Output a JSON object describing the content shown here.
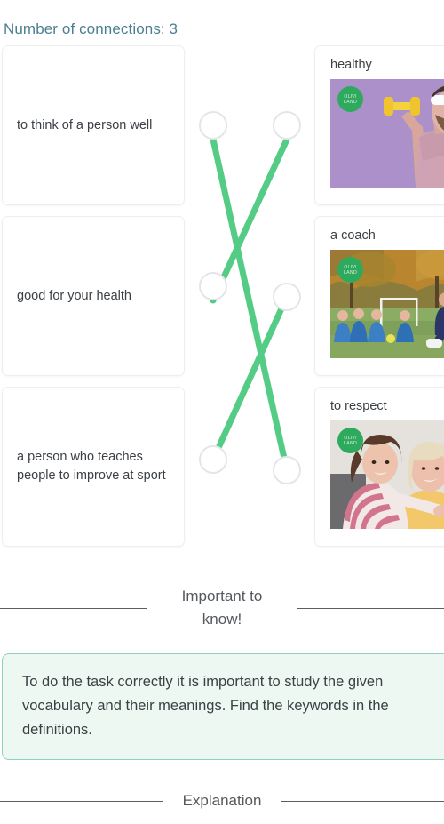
{
  "header": {
    "connections_label": "Number of connections: 3",
    "accent_color": "#4b7f92"
  },
  "match_task": {
    "definitions": [
      {
        "id": "def-1",
        "text": "to think of a person well"
      },
      {
        "id": "def-2",
        "text": "good for your health"
      },
      {
        "id": "def-3",
        "text": "a person who teaches people to improve at sport"
      }
    ],
    "terms": [
      {
        "id": "term-1",
        "label": "healthy",
        "image_alt": "man in pink t-shirt with white headband lifting a yellow dumbbell on a purple background",
        "badge_line1": "OLIVI",
        "badge_line2": "LAND"
      },
      {
        "id": "term-2",
        "label": "a coach",
        "image_alt": "coach kneeling beside children in blue kits sitting on a football pitch",
        "badge_line1": "OLIVI",
        "badge_line2": "LAND"
      },
      {
        "id": "term-3",
        "label": "to respect",
        "image_alt": "girl in striped shirt hugging a smiling older woman",
        "badge_line1": "OLIVI",
        "badge_line2": "LAND"
      }
    ],
    "connection_color": "#54cc86",
    "node_color": "#e3e6e8",
    "connections": [
      {
        "from": "def-1",
        "to": "term-3"
      },
      {
        "from": "def-2",
        "to": "term-1"
      },
      {
        "from": "def-3",
        "to": "term-2"
      }
    ]
  },
  "sections": [
    {
      "id": "important",
      "label": "Important to know!"
    },
    {
      "id": "explanation",
      "label": "Explanation"
    }
  ],
  "info_box": {
    "text": "To do the task correctly it is important to study the given vocabulary and their meanings. Find the keywords in the definitions.",
    "border_color": "#8fd0be",
    "background_color": "#edf8f2"
  }
}
